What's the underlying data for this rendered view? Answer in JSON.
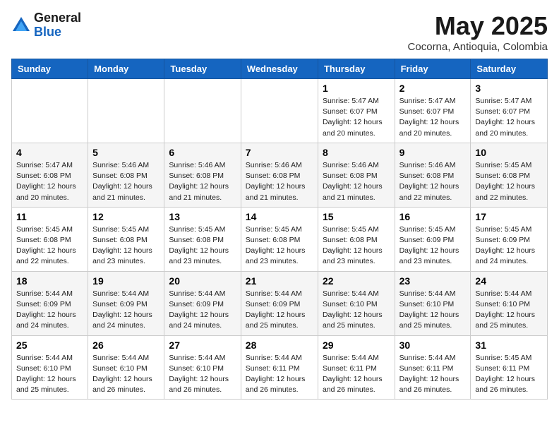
{
  "header": {
    "logo_general": "General",
    "logo_blue": "Blue",
    "month_title": "May 2025",
    "location": "Cocorna, Antioquia, Colombia"
  },
  "days_of_week": [
    "Sunday",
    "Monday",
    "Tuesday",
    "Wednesday",
    "Thursday",
    "Friday",
    "Saturday"
  ],
  "weeks": [
    {
      "days": [
        {
          "num": "",
          "info": ""
        },
        {
          "num": "",
          "info": ""
        },
        {
          "num": "",
          "info": ""
        },
        {
          "num": "",
          "info": ""
        },
        {
          "num": "1",
          "info": "Sunrise: 5:47 AM\nSunset: 6:07 PM\nDaylight: 12 hours\nand 20 minutes."
        },
        {
          "num": "2",
          "info": "Sunrise: 5:47 AM\nSunset: 6:07 PM\nDaylight: 12 hours\nand 20 minutes."
        },
        {
          "num": "3",
          "info": "Sunrise: 5:47 AM\nSunset: 6:07 PM\nDaylight: 12 hours\nand 20 minutes."
        }
      ]
    },
    {
      "days": [
        {
          "num": "4",
          "info": "Sunrise: 5:47 AM\nSunset: 6:08 PM\nDaylight: 12 hours\nand 20 minutes."
        },
        {
          "num": "5",
          "info": "Sunrise: 5:46 AM\nSunset: 6:08 PM\nDaylight: 12 hours\nand 21 minutes."
        },
        {
          "num": "6",
          "info": "Sunrise: 5:46 AM\nSunset: 6:08 PM\nDaylight: 12 hours\nand 21 minutes."
        },
        {
          "num": "7",
          "info": "Sunrise: 5:46 AM\nSunset: 6:08 PM\nDaylight: 12 hours\nand 21 minutes."
        },
        {
          "num": "8",
          "info": "Sunrise: 5:46 AM\nSunset: 6:08 PM\nDaylight: 12 hours\nand 21 minutes."
        },
        {
          "num": "9",
          "info": "Sunrise: 5:46 AM\nSunset: 6:08 PM\nDaylight: 12 hours\nand 22 minutes."
        },
        {
          "num": "10",
          "info": "Sunrise: 5:45 AM\nSunset: 6:08 PM\nDaylight: 12 hours\nand 22 minutes."
        }
      ]
    },
    {
      "days": [
        {
          "num": "11",
          "info": "Sunrise: 5:45 AM\nSunset: 6:08 PM\nDaylight: 12 hours\nand 22 minutes."
        },
        {
          "num": "12",
          "info": "Sunrise: 5:45 AM\nSunset: 6:08 PM\nDaylight: 12 hours\nand 23 minutes."
        },
        {
          "num": "13",
          "info": "Sunrise: 5:45 AM\nSunset: 6:08 PM\nDaylight: 12 hours\nand 23 minutes."
        },
        {
          "num": "14",
          "info": "Sunrise: 5:45 AM\nSunset: 6:08 PM\nDaylight: 12 hours\nand 23 minutes."
        },
        {
          "num": "15",
          "info": "Sunrise: 5:45 AM\nSunset: 6:08 PM\nDaylight: 12 hours\nand 23 minutes."
        },
        {
          "num": "16",
          "info": "Sunrise: 5:45 AM\nSunset: 6:09 PM\nDaylight: 12 hours\nand 23 minutes."
        },
        {
          "num": "17",
          "info": "Sunrise: 5:45 AM\nSunset: 6:09 PM\nDaylight: 12 hours\nand 24 minutes."
        }
      ]
    },
    {
      "days": [
        {
          "num": "18",
          "info": "Sunrise: 5:44 AM\nSunset: 6:09 PM\nDaylight: 12 hours\nand 24 minutes."
        },
        {
          "num": "19",
          "info": "Sunrise: 5:44 AM\nSunset: 6:09 PM\nDaylight: 12 hours\nand 24 minutes."
        },
        {
          "num": "20",
          "info": "Sunrise: 5:44 AM\nSunset: 6:09 PM\nDaylight: 12 hours\nand 24 minutes."
        },
        {
          "num": "21",
          "info": "Sunrise: 5:44 AM\nSunset: 6:09 PM\nDaylight: 12 hours\nand 25 minutes."
        },
        {
          "num": "22",
          "info": "Sunrise: 5:44 AM\nSunset: 6:10 PM\nDaylight: 12 hours\nand 25 minutes."
        },
        {
          "num": "23",
          "info": "Sunrise: 5:44 AM\nSunset: 6:10 PM\nDaylight: 12 hours\nand 25 minutes."
        },
        {
          "num": "24",
          "info": "Sunrise: 5:44 AM\nSunset: 6:10 PM\nDaylight: 12 hours\nand 25 minutes."
        }
      ]
    },
    {
      "days": [
        {
          "num": "25",
          "info": "Sunrise: 5:44 AM\nSunset: 6:10 PM\nDaylight: 12 hours\nand 25 minutes."
        },
        {
          "num": "26",
          "info": "Sunrise: 5:44 AM\nSunset: 6:10 PM\nDaylight: 12 hours\nand 26 minutes."
        },
        {
          "num": "27",
          "info": "Sunrise: 5:44 AM\nSunset: 6:10 PM\nDaylight: 12 hours\nand 26 minutes."
        },
        {
          "num": "28",
          "info": "Sunrise: 5:44 AM\nSunset: 6:11 PM\nDaylight: 12 hours\nand 26 minutes."
        },
        {
          "num": "29",
          "info": "Sunrise: 5:44 AM\nSunset: 6:11 PM\nDaylight: 12 hours\nand 26 minutes."
        },
        {
          "num": "30",
          "info": "Sunrise: 5:44 AM\nSunset: 6:11 PM\nDaylight: 12 hours\nand 26 minutes."
        },
        {
          "num": "31",
          "info": "Sunrise: 5:45 AM\nSunset: 6:11 PM\nDaylight: 12 hours\nand 26 minutes."
        }
      ]
    }
  ]
}
